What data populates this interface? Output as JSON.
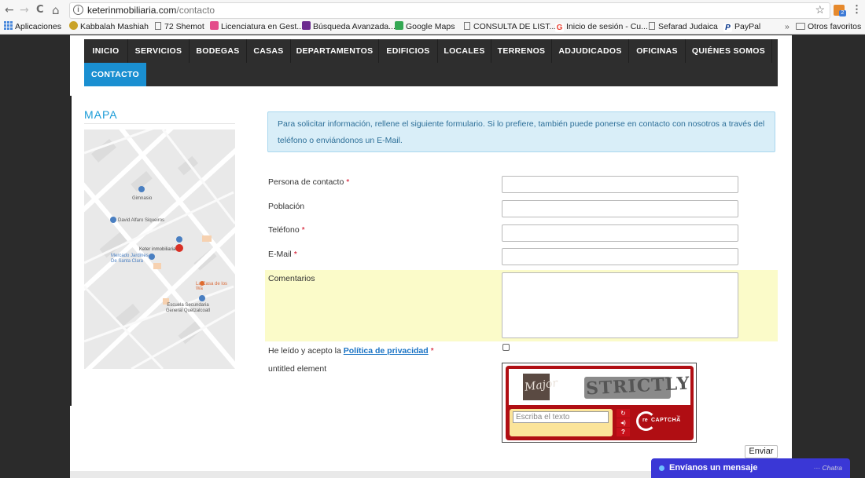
{
  "browser": {
    "url_domain": "keterinmobiliaria.com",
    "url_path": "/contacto",
    "info_icon": "i",
    "star_icon": "☆",
    "menu_icon": "⋮",
    "back_icon": "←",
    "forward_icon": "→",
    "reload_icon": "C",
    "home_icon": "⌂",
    "ext_badge": "2"
  },
  "bookmarks": {
    "items": [
      {
        "label": "Aplicaciones",
        "icon": "apps-grid-icon",
        "color": "#4a89dc"
      },
      {
        "label": "Kabbalah Mashiah",
        "icon": "star-of-david-icon",
        "color": "#b8860b"
      },
      {
        "label": "72 Shemot",
        "icon": "page-icon",
        "color": "#777777"
      },
      {
        "label": "Licenciatura en Gest...",
        "icon": "site-icon",
        "color": "#e34c8a"
      },
      {
        "label": "Búsqueda Avanzada...",
        "icon": "site-icon",
        "color": "#6b2a8e"
      },
      {
        "label": "Google Maps",
        "icon": "maps-icon",
        "color": "#34a853"
      },
      {
        "label": "CONSULTA DE LIST...",
        "icon": "page-icon",
        "color": "#777777"
      },
      {
        "label": "Inicio de sesión - Cu...",
        "icon": "google-icon",
        "color": "#ea4335"
      },
      {
        "label": "Sefarad Judaica",
        "icon": "page-icon",
        "color": "#777777"
      },
      {
        "label": "PayPal",
        "icon": "paypal-icon",
        "color": "#003087"
      }
    ],
    "more": "»",
    "other": "Otros favoritos"
  },
  "nav": {
    "items": [
      "INICIO",
      "SERVICIOS",
      "BODEGAS",
      "CASAS",
      "DEPARTAMENTOS",
      "EDIFICIOS",
      "LOCALES",
      "TERRENOS",
      "ADJUDICADOS",
      "OFICINAS",
      "QUIÉNES SOMOS"
    ],
    "active": "CONTACTO"
  },
  "map": {
    "title": "MAPA",
    "labels": [
      "Gimnasio",
      "David Alfaro Siqueiros",
      "Keter inmobiliaria",
      "Mercado Jardines De Santa Clara",
      "La Casa de los Wa",
      "Escuela Secundaria General Quetzalcoatl"
    ]
  },
  "form": {
    "intro": "Para solicitar información, rellene el siguiente formulario. Si lo prefiere, también puede ponerse en contacto con nosotros  a través del teléfono o enviándonos un E-Mail.",
    "fields": {
      "contact": "Persona de contacto",
      "city": "Población",
      "phone": "Teléfono",
      "email": "E-Mail",
      "comments": "Comentarios"
    },
    "required_mark": "*",
    "privacy_prefix": "He leído y acepto la ",
    "privacy_link": "Política de privacidad",
    "untitled": "untitled element",
    "send": "Enviar"
  },
  "captcha": {
    "word1": "Major",
    "word2": "STRICTLY",
    "placeholder": "Escriba el texto",
    "logo_re": "re",
    "logo_text": "CAPTCHA",
    "logo_tm": "™"
  },
  "chat": {
    "label": "Envíanos un mensaje",
    "brand": "Chatra"
  }
}
